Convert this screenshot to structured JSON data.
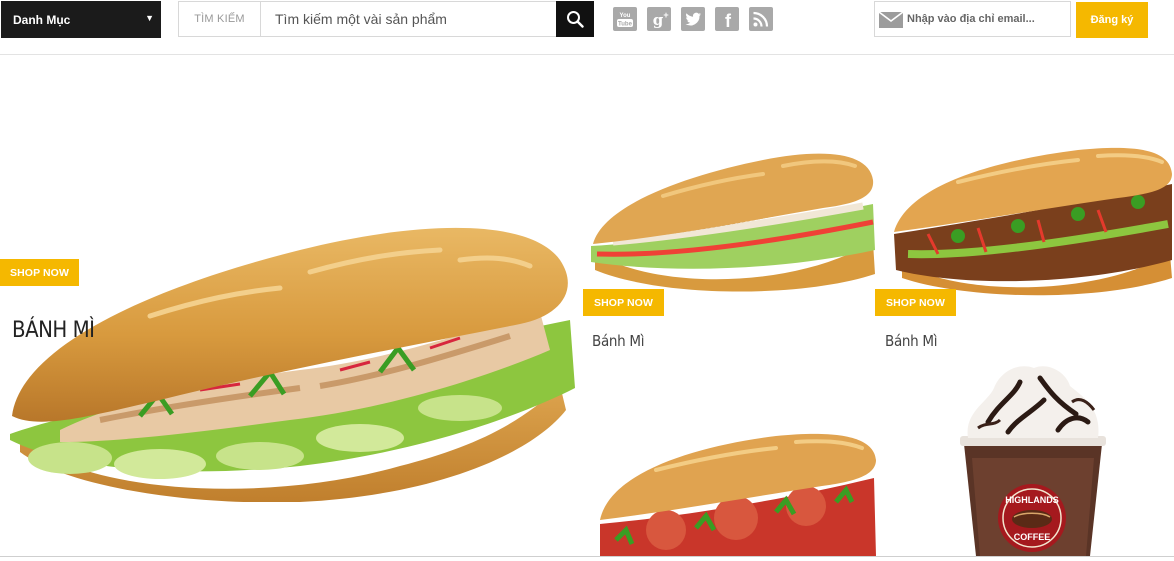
{
  "header": {
    "category": {
      "label": "Danh Mục",
      "chevron_icon": "triangle-down-icon"
    },
    "search": {
      "label": "TÌM KIẾM",
      "placeholder": "Tìm kiếm một vài sản phẩm",
      "button_icon": "search-icon"
    },
    "social": [
      {
        "name": "youtube-icon",
        "glyph": "You Tube"
      },
      {
        "name": "google-plus-icon",
        "glyph": "g+"
      },
      {
        "name": "twitter-icon",
        "glyph": ""
      },
      {
        "name": "facebook-icon",
        "glyph": "f"
      },
      {
        "name": "rss-icon",
        "glyph": ""
      }
    ],
    "newsletter": {
      "placeholder": "Nhập vào địa chỉ email...",
      "button_label": "Đăng ký",
      "icon": "mail-icon"
    }
  },
  "hero": {
    "shop_label": "SHOP NOW",
    "title": "BÁNH MÌ"
  },
  "products": [
    {
      "shop_label": "SHOP NOW",
      "name": "Bánh Mì"
    },
    {
      "shop_label": "SHOP NOW",
      "name": "Bánh Mì"
    }
  ],
  "images": {
    "hero": "banh-mi-grilled-chicken",
    "product_1": "banh-mi-cha-lua",
    "product_2": "banh-mi-grilled-beef",
    "product_3": "banh-mi-meatball",
    "product_4": "highlands-coffee-freeze"
  },
  "coffee_logo": {
    "line1": "HIGHLANDS",
    "line2": "COFFEE"
  },
  "colors": {
    "accent": "#f5b800",
    "dark": "#1b1b1b",
    "social_gray": "#a9a9a9"
  }
}
